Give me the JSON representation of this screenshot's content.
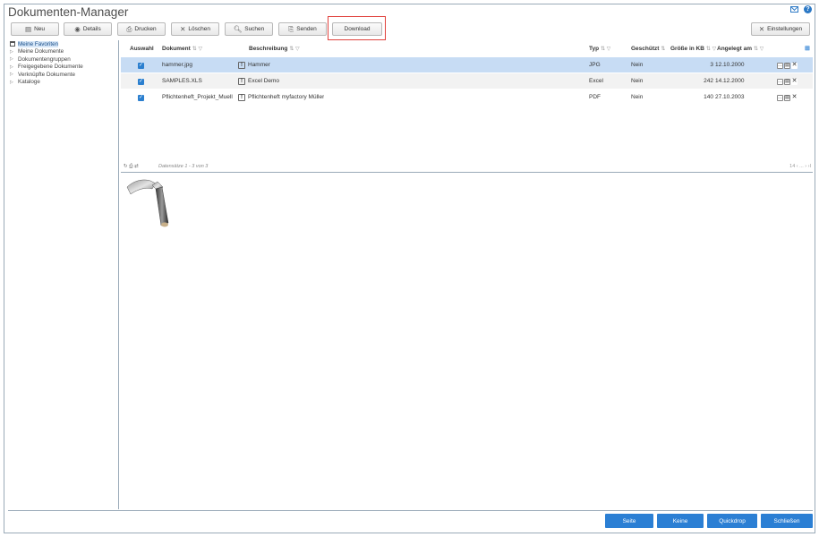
{
  "app": {
    "title": "Dokumenten-Manager"
  },
  "toolbar": {
    "new_label": "Neu",
    "details_label": "Details",
    "print_label": "Drucken",
    "delete_label": "Löschen",
    "search_label": "Suchen",
    "send_label": "Senden",
    "download_label": "Download",
    "settings_label": "Einstellungen"
  },
  "sidebar": {
    "items": [
      {
        "label": "Meine Favoriten",
        "icon": "favorites-list-icon",
        "active": true
      },
      {
        "label": "Meine Dokumente",
        "icon": "triangle-right-icon"
      },
      {
        "label": "Dokumentengruppen",
        "icon": "triangle-right-icon"
      },
      {
        "label": "Freigegebene Dokumente",
        "icon": "triangle-right-icon"
      },
      {
        "label": "Verknüpfte Dokumente",
        "icon": "triangle-right-icon"
      },
      {
        "label": "Kataloge",
        "icon": "triangle-right-icon"
      }
    ]
  },
  "grid": {
    "columns": {
      "select": "Auswahl",
      "document": "Dokument",
      "description": "Beschreibung",
      "type": "Typ",
      "protected": "Geschützt",
      "size": "Größe in KB",
      "created": "Angelegt am"
    },
    "rows": [
      {
        "document": "hammer.jpg",
        "description": "Hammer",
        "type": "JPG",
        "protected": "Nein",
        "size": "3",
        "created": "12.10.2000"
      },
      {
        "document": "SAMPLES.XLS",
        "description": "Excel Demo",
        "type": "Excel",
        "protected": "Nein",
        "size": "242",
        "created": "14.12.2000"
      },
      {
        "document": "Pflichtenheft_Projekt_Muell",
        "description": "Pflichtenheft myfactory Müller",
        "type": "PDF",
        "protected": "Nein",
        "size": "140",
        "created": "27.10.2003"
      }
    ],
    "footer_text": "Datensätze 1 - 3 von 3",
    "pager_text": "14 ‹ ... › ›I"
  },
  "bottom": {
    "seite_label": "Seite",
    "keine_label": "Keine",
    "quickdrop_label": "Quickdrop",
    "close_label": "Schließen"
  },
  "colors": {
    "accent": "#2b7fd4",
    "selected_row": "#c7dcf4",
    "highlight_box": "#e0413c"
  }
}
